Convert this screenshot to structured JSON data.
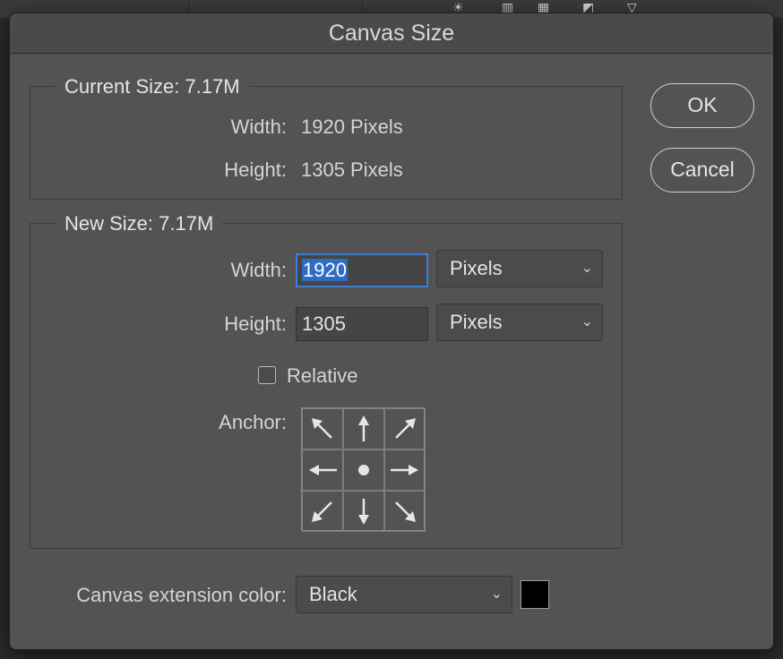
{
  "dialog": {
    "title": "Canvas Size"
  },
  "current_size": {
    "title": "Current Size: 7.17M",
    "width_label": "Width:",
    "width_value": "1920 Pixels",
    "height_label": "Height:",
    "height_value": "1305 Pixels"
  },
  "new_size": {
    "title": "New Size: 7.17M",
    "width_label": "Width:",
    "width_value": "1920",
    "width_unit": "Pixels",
    "height_label": "Height:",
    "height_value": "1305",
    "height_unit": "Pixels",
    "relative_label": "Relative",
    "relative_checked": false,
    "anchor_label": "Anchor:",
    "anchor_cells": [
      "arrow-nw-icon",
      "arrow-n-icon",
      "arrow-ne-icon",
      "arrow-w-icon",
      "anchor-center-dot-icon",
      "arrow-e-icon",
      "arrow-sw-icon",
      "arrow-s-icon",
      "arrow-se-icon"
    ]
  },
  "buttons": {
    "ok": "OK",
    "cancel": "Cancel"
  },
  "extension": {
    "label": "Canvas extension color:",
    "value": "Black",
    "swatch_color": "#000000"
  },
  "colors": {
    "dialog_bg": "#535353",
    "focus_ring": "#3d7dd6",
    "selection": "#2f6cc4"
  }
}
